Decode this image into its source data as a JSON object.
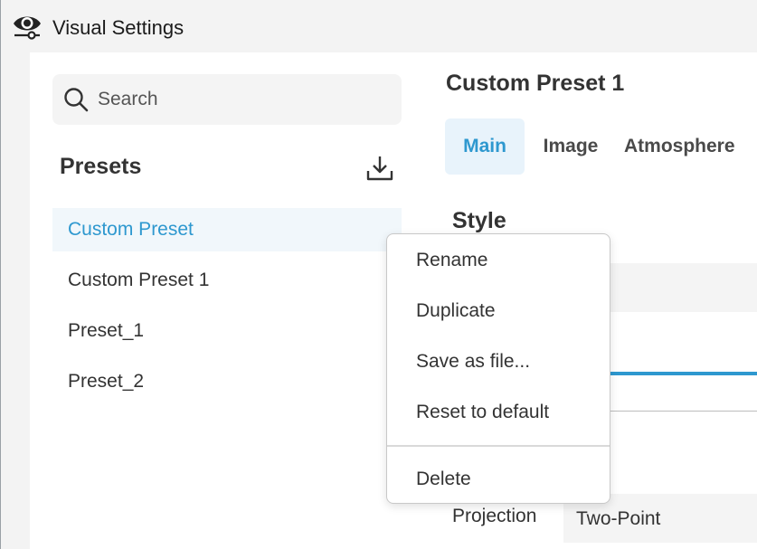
{
  "window": {
    "title": "Visual Settings",
    "app_icon": "eye-icon"
  },
  "sidebar": {
    "search": {
      "placeholder": "Search",
      "value": ""
    },
    "presets_title": "Presets",
    "download_icon": "download-icon",
    "presets": [
      {
        "label": "Custom Preset",
        "selected": true
      },
      {
        "label": "Custom Preset 1",
        "selected": false
      },
      {
        "label": "Preset_1",
        "selected": false
      },
      {
        "label": "Preset_2",
        "selected": false
      }
    ]
  },
  "panel": {
    "title": "Custom Preset 1",
    "tabs": [
      {
        "label": "Main",
        "active": true
      },
      {
        "label": "Image",
        "active": false
      },
      {
        "label": "Atmosphere",
        "active": false
      }
    ],
    "section_title": "Style",
    "projection": {
      "label": "Projection",
      "value": "Two-Point"
    }
  },
  "context_menu": {
    "items": [
      "Rename",
      "Duplicate",
      "Save as file...",
      "Reset to default"
    ],
    "danger_item": "Delete"
  },
  "colors": {
    "accent": "#2e98cf",
    "selected_bg": "#f1f7fb",
    "tab_active_bg": "#e8f3fb"
  }
}
